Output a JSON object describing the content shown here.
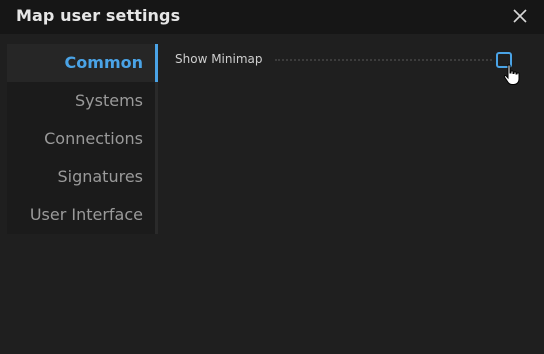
{
  "window": {
    "title": "Map user settings",
    "close_icon": "close-icon"
  },
  "sidebar": {
    "items": [
      {
        "label": "Common",
        "active": true
      },
      {
        "label": "Systems",
        "active": false
      },
      {
        "label": "Connections",
        "active": false
      },
      {
        "label": "Signatures",
        "active": false
      },
      {
        "label": "User Interface",
        "active": false
      }
    ]
  },
  "common": {
    "settings": [
      {
        "label": "Show Minimap",
        "checked": false
      }
    ]
  },
  "colors": {
    "accent": "#4aa3e6",
    "background": "#1f1f1f",
    "titlebar": "#161616",
    "text": "#cfcfcf",
    "muted_text": "#9a9a9a"
  }
}
